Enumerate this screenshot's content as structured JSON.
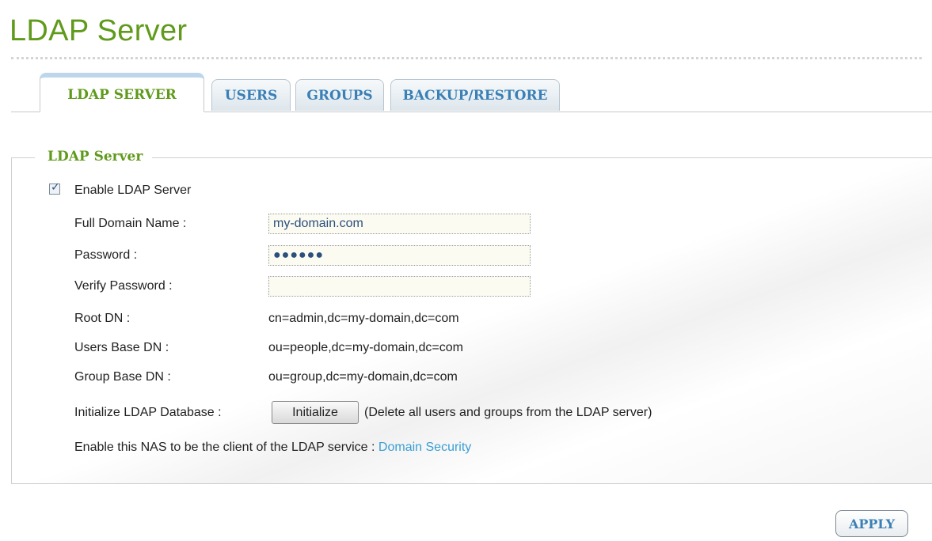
{
  "page": {
    "title": "LDAP Server"
  },
  "tabs": [
    {
      "label": "LDAP SERVER",
      "active": true
    },
    {
      "label": "USERS",
      "active": false
    },
    {
      "label": "GROUPS",
      "active": false
    },
    {
      "label": "BACKUP/RESTORE",
      "active": false
    }
  ],
  "section": {
    "legend": "LDAP Server"
  },
  "form": {
    "enable_label": "Enable LDAP Server",
    "enable_checked": true,
    "full_domain_label": "Full Domain Name :",
    "full_domain_value": "my-domain.com",
    "password_label": "Password :",
    "password_value": "●●●●●●",
    "verify_password_label": "Verify Password :",
    "verify_password_value": "",
    "root_dn_label": "Root DN :",
    "root_dn_value": "cn=admin,dc=my-domain,dc=com",
    "users_base_dn_label": "Users Base DN :",
    "users_base_dn_value": "ou=people,dc=my-domain,dc=com",
    "group_base_dn_label": "Group Base DN :",
    "group_base_dn_value": "ou=group,dc=my-domain,dc=com",
    "init_db_label": "Initialize LDAP Database :",
    "init_button_label": "Initialize",
    "init_note": "(Delete all users and groups from the LDAP server)",
    "client_text": "Enable this NAS to be the client of the LDAP service : ",
    "client_link": "Domain Security"
  },
  "footer": {
    "apply_label": "APPLY"
  },
  "colors": {
    "accent_green": "#5f9a1b",
    "link_blue": "#3a9ed3",
    "tab_blue": "#3a7fb5"
  }
}
